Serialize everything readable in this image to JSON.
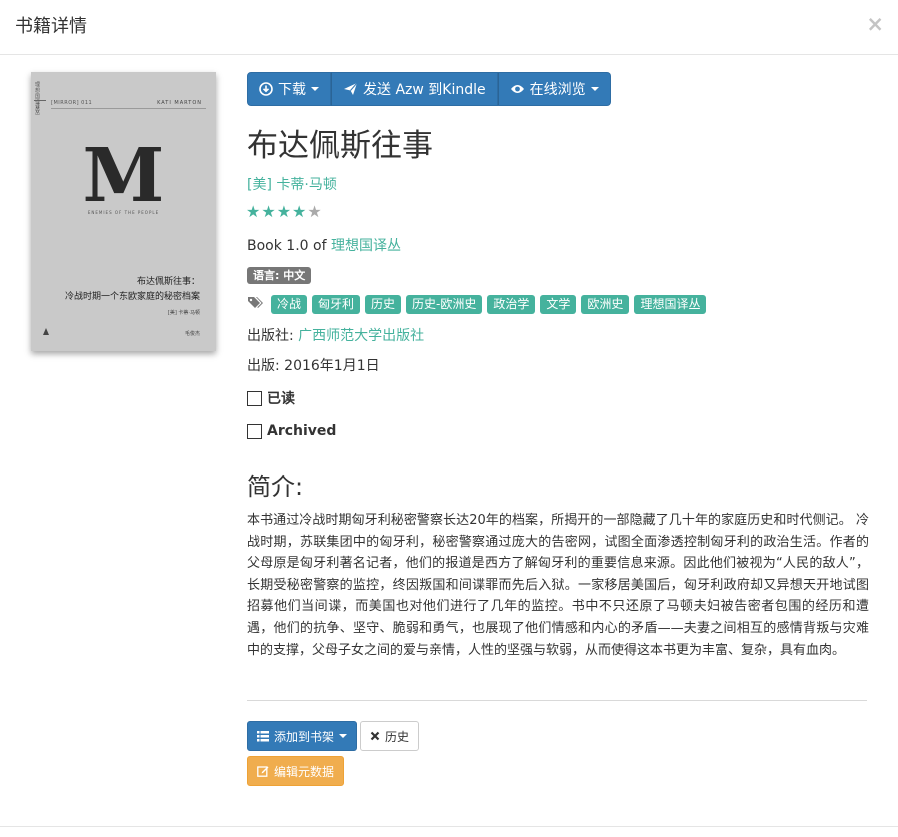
{
  "modal": {
    "title": "书籍详情",
    "close": "×"
  },
  "cover": {
    "series_vertical": "理想国译丛",
    "translator_vertical": "译丛",
    "mini_bar": "[MIRROR] 011",
    "author_en": "KATI MARTON",
    "big_letter": "M",
    "subtitle_en": "ENEMIES OF THE PEOPLE",
    "title_cn_line1": "布达佩斯往事：",
    "title_cn_line2": "冷战时期一个东欧家庭的秘密档案",
    "author_cn": "[美] 卡蒂·马顿",
    "translator_cn": "毛俊杰",
    "publisher_mark": "广西师范大学出版社"
  },
  "actions": {
    "download": "下载",
    "send_kindle": "发送 Azw 到Kindle",
    "read_online": "在线浏览"
  },
  "book": {
    "title": "布达佩斯往事",
    "author": "[美] 卡蒂·马顿",
    "rating": 4,
    "rating_max": 5,
    "series_prefix": "Book 1.0 of ",
    "series_name": "理想国译丛",
    "language": "语言: 中文",
    "tags": [
      "冷战",
      "匈牙利",
      "历史",
      "历史-欧洲史",
      "政治学",
      "文学",
      "欧洲史",
      "理想国译丛"
    ],
    "publisher_label": "出版社: ",
    "publisher": "广西师范大学出版社",
    "pubdate": "出版: 2016年1月1日",
    "read_label": "已读",
    "read_checked": false,
    "archived_label": "Archived",
    "archived_checked": false
  },
  "description": {
    "heading": "简介:",
    "text": "本书通过冷战时期匈牙利秘密警察长达20年的档案，所揭开的一部隐藏了几十年的家庭历史和时代侧记。 冷战时期，苏联集团中的匈牙利，秘密警察通过庞大的告密网，试图全面渗透控制匈牙利的政治生活。作者的父母原是匈牙利著名记者，他们的报道是西方了解匈牙利的重要信息来源。因此他们被视为“人民的敌人”，长期受秘密警察的监控，终因叛国和间谍罪而先后入狱。一家移居美国后，匈牙利政府却又异想天开地试图招募他们当间谍，而美国也对他们进行了几年的监控。书中不只还原了马顿夫妇被告密者包围的经历和遭遇，他们的抗争、坚守、脆弱和勇气，也展现了他们情感和内心的矛盾——夫妻之间相互的感情背叛与灾难中的支撑，父母子女之间的爱与亲情，人性的坚强与软弱，从而使得这本书更为丰富、复杂，具有血肉。"
  },
  "footer": {
    "add_to_shelf": "添加到书架",
    "history": "历史",
    "edit_metadata": "编辑元数据"
  },
  "colors": {
    "primary": "#337ab7",
    "accent": "#45b29d",
    "warning": "#f0ad4e",
    "badge": "#777777"
  }
}
